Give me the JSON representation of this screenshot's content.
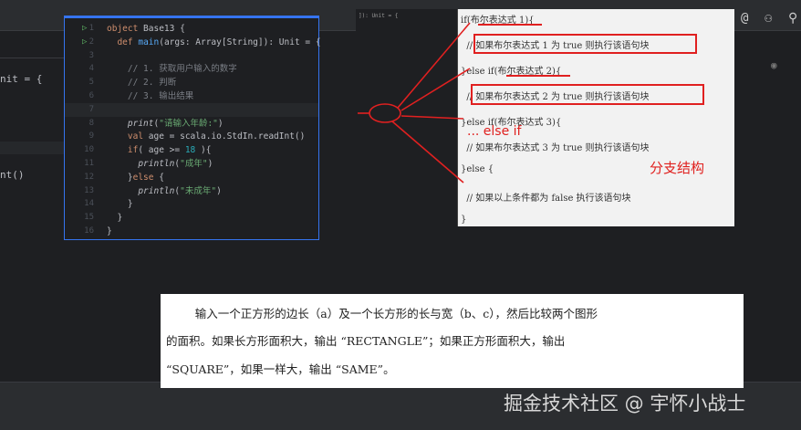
{
  "background_code": {
    "line_a": "nit = {",
    "line_b": "nt()"
  },
  "editor": {
    "lines": [
      {
        "n": "1",
        "run": true,
        "parts": [
          [
            "kw",
            "object "
          ],
          [
            "",
            "Base13 {"
          ]
        ]
      },
      {
        "n": "2",
        "run": true,
        "parts": [
          [
            "",
            "  "
          ],
          [
            "kw",
            "def "
          ],
          [
            "fn",
            "main"
          ],
          [
            "",
            "(args: Array[String]): Unit = {"
          ]
        ]
      },
      {
        "n": "3",
        "parts": []
      },
      {
        "n": "4",
        "parts": [
          [
            "cm",
            "    // 1. 获取用户输入的数字"
          ]
        ]
      },
      {
        "n": "5",
        "parts": [
          [
            "cm",
            "    // 2. 判断"
          ]
        ]
      },
      {
        "n": "6",
        "parts": [
          [
            "cm",
            "    // 3. 输出结果"
          ]
        ]
      },
      {
        "n": "7",
        "cur": true,
        "parts": []
      },
      {
        "n": "8",
        "parts": [
          [
            "",
            "    "
          ],
          [
            "it",
            "print"
          ],
          [
            "",
            "("
          ],
          [
            "st",
            "\"请输入年龄:\""
          ],
          [
            "",
            ")"
          ]
        ]
      },
      {
        "n": "9",
        "parts": [
          [
            "",
            "    "
          ],
          [
            "kw",
            "val "
          ],
          [
            "",
            "age = scala.io.StdIn.readInt()"
          ]
        ]
      },
      {
        "n": "10",
        "parts": [
          [
            "",
            "    "
          ],
          [
            "kw",
            "if"
          ],
          [
            "",
            "( age >= "
          ],
          [
            "nm",
            "18"
          ],
          [
            "",
            " ){"
          ]
        ]
      },
      {
        "n": "11",
        "parts": [
          [
            "",
            "      "
          ],
          [
            "it",
            "println"
          ],
          [
            "",
            "("
          ],
          [
            "st",
            "\"成年\""
          ],
          [
            "",
            ")"
          ]
        ]
      },
      {
        "n": "12",
        "parts": [
          [
            "",
            "    }"
          ],
          [
            "kw",
            "else"
          ],
          [
            "",
            " {"
          ]
        ]
      },
      {
        "n": "13",
        "parts": [
          [
            "",
            "      "
          ],
          [
            "it",
            "println"
          ],
          [
            "",
            "("
          ],
          [
            "st",
            "\"未成年\""
          ],
          [
            "",
            ")"
          ]
        ]
      },
      {
        "n": "14",
        "parts": [
          [
            "",
            "    }"
          ]
        ]
      },
      {
        "n": "15",
        "parts": [
          [
            "",
            "  }"
          ]
        ]
      },
      {
        "n": "16",
        "parts": [
          [
            "",
            "}"
          ]
        ]
      }
    ]
  },
  "overlay_dark": {
    "text": "]): Unit = {"
  },
  "diagram": {
    "l1": "if(布尔表达式 1){",
    "l2": "  // 如果布尔表达式 1 为 true 则执行该语句块",
    "l3": "}else if(布尔表达式 2){",
    "l4": "  // 如果布尔表达式 2 为 true 则执行该语句块",
    "l5": "}else if(布尔表达式 3){",
    "l6": "  // 如果布尔表达式 3 为 true 则执行该语句块",
    "l7": "}else {",
    "l8": "  // 如果以上条件都为 false 执行该语句块",
    "l9": "}",
    "annot_elseif": "... else if",
    "annot_title": "分支结构",
    "accent": "#e02020"
  },
  "toolbar": {
    "icons": [
      "ai-assistant-icon",
      "add-user-icon",
      "search-icon"
    ]
  },
  "task": {
    "p1": "        输入一个正方形的边长（a）及一个长方形的长与宽（b、c），然后比较两个图形",
    "p2": "的面积。如果长方形面积大，输出 “RECTANGLE”；如果正方形面积大，输出",
    "p3": "“SQUARE”，如果一样大，输出 “SAME”。"
  },
  "watermark": "掘金技术社区 @ 宇怀小战士"
}
